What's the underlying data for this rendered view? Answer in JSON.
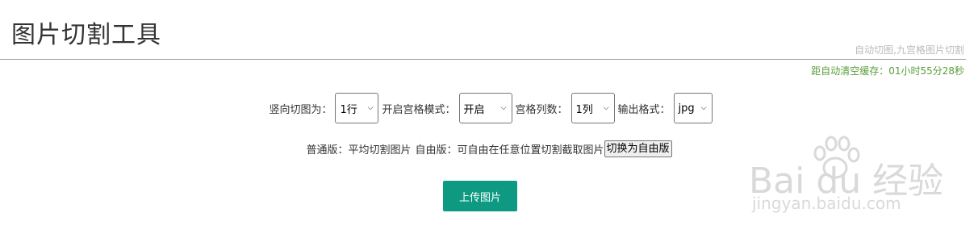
{
  "header": {
    "title": "图片切割工具",
    "tagline": "自动切图,九宫格图片切割",
    "cache_timer": "距自动清空缓存：01小时55分28秒"
  },
  "controls": {
    "vertical_cut_label": "竖向切图为：",
    "vertical_cut_value": "1行",
    "grid_mode_label": "开启宫格模式：",
    "grid_mode_value": "开启",
    "grid_columns_label": "宫格列数：",
    "grid_columns_value": "1列",
    "output_format_label": "输出格式：",
    "output_format_value": "jpg"
  },
  "modes": {
    "normal_text": "普通版：平均切割图片",
    "free_text": "自由版：可自由在任意位置切割截取图片",
    "switch_button": "切换为自由版"
  },
  "upload_button": "上传图片",
  "watermark": {
    "brand": "Bai du 经验",
    "url": "jingyan.baidu.com"
  },
  "colors": {
    "accent": "#0e9a82",
    "timer": "#5a9e3a",
    "muted": "#bbbbbb"
  }
}
